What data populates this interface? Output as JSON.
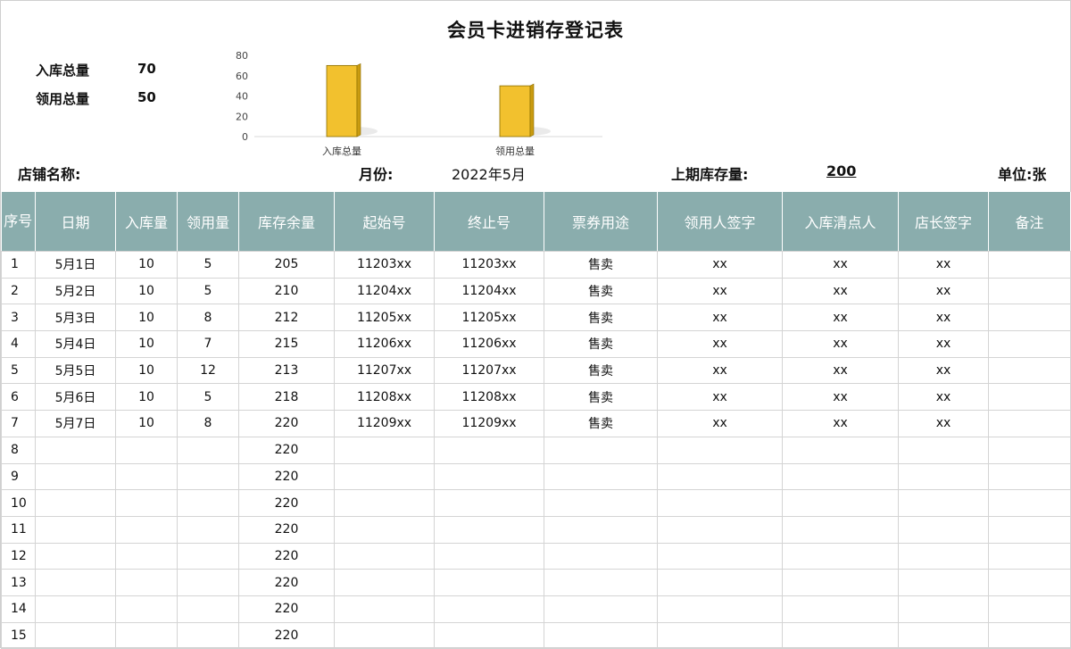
{
  "title": "会员卡进销存登记表",
  "summary": [
    {
      "label": "入库总量",
      "value": "70"
    },
    {
      "label": "领用总量",
      "value": "50"
    }
  ],
  "chart_data": {
    "type": "bar",
    "categories": [
      "入库总量",
      "领用总量"
    ],
    "values": [
      70,
      50
    ],
    "ylim": [
      0,
      80
    ],
    "yticks": [
      "80",
      "60",
      "40",
      "20",
      "0"
    ],
    "bar_color": "#f2c12e"
  },
  "info": {
    "store_label": "店铺名称:",
    "month_label": "月份:",
    "month_value": "2022年5月",
    "prev_stock_label": "上期库存量:",
    "prev_stock_value": "200",
    "unit_label": "单位:张"
  },
  "table": {
    "headers": [
      "序号",
      "日期",
      "入库量",
      "领用量",
      "库存余量",
      "起始号",
      "终止号",
      "票券用途",
      "领用人签字",
      "入库清点人",
      "店长签字",
      "备注"
    ],
    "rows": [
      [
        "1",
        "5月1日",
        "10",
        "5",
        "205",
        "11203xx",
        "11203xx",
        "售卖",
        "xx",
        "xx",
        "xx",
        ""
      ],
      [
        "2",
        "5月2日",
        "10",
        "5",
        "210",
        "11204xx",
        "11204xx",
        "售卖",
        "xx",
        "xx",
        "xx",
        ""
      ],
      [
        "3",
        "5月3日",
        "10",
        "8",
        "212",
        "11205xx",
        "11205xx",
        "售卖",
        "xx",
        "xx",
        "xx",
        ""
      ],
      [
        "4",
        "5月4日",
        "10",
        "7",
        "215",
        "11206xx",
        "11206xx",
        "售卖",
        "xx",
        "xx",
        "xx",
        ""
      ],
      [
        "5",
        "5月5日",
        "10",
        "12",
        "213",
        "11207xx",
        "11207xx",
        "售卖",
        "xx",
        "xx",
        "xx",
        ""
      ],
      [
        "6",
        "5月6日",
        "10",
        "5",
        "218",
        "11208xx",
        "11208xx",
        "售卖",
        "xx",
        "xx",
        "xx",
        ""
      ],
      [
        "7",
        "5月7日",
        "10",
        "8",
        "220",
        "11209xx",
        "11209xx",
        "售卖",
        "xx",
        "xx",
        "xx",
        ""
      ],
      [
        "8",
        "",
        "",
        "",
        "220",
        "",
        "",
        "",
        "",
        "",
        "",
        ""
      ],
      [
        "9",
        "",
        "",
        "",
        "220",
        "",
        "",
        "",
        "",
        "",
        "",
        ""
      ],
      [
        "10",
        "",
        "",
        "",
        "220",
        "",
        "",
        "",
        "",
        "",
        "",
        ""
      ],
      [
        "11",
        "",
        "",
        "",
        "220",
        "",
        "",
        "",
        "",
        "",
        "",
        ""
      ],
      [
        "12",
        "",
        "",
        "",
        "220",
        "",
        "",
        "",
        "",
        "",
        "",
        ""
      ],
      [
        "13",
        "",
        "",
        "",
        "220",
        "",
        "",
        "",
        "",
        "",
        "",
        ""
      ],
      [
        "14",
        "",
        "",
        "",
        "220",
        "",
        "",
        "",
        "",
        "",
        "",
        ""
      ],
      [
        "15",
        "",
        "",
        "",
        "220",
        "",
        "",
        "",
        "",
        "",
        "",
        ""
      ]
    ]
  }
}
